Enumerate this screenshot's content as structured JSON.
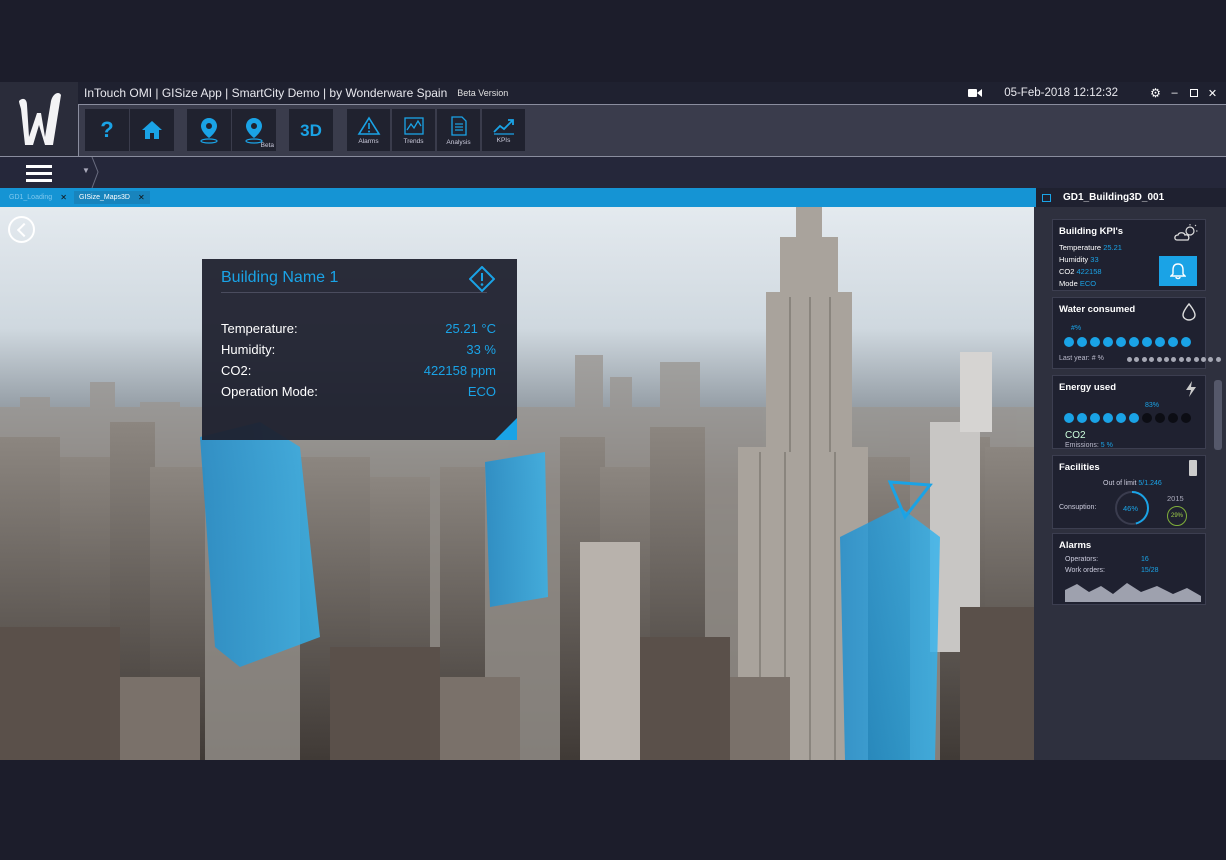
{
  "title_bar": {
    "app_title": "InTouch OMI | GISize App | SmartCity Demo | by Wonderware Spain",
    "beta_tag": "Beta Version",
    "datetime": "05-Feb-2018 12:12:32"
  },
  "toolbar": {
    "help_glyph": "?",
    "three_d_label": "3D",
    "location_beta_label": "Beta",
    "alarms_label": "Alarms",
    "trends_label": "Trends",
    "analysis_label": "Analysis",
    "kpis_label": "KPIs"
  },
  "tabs": [
    {
      "label": "GD1_Loading"
    },
    {
      "label": "GISize_Maps3D"
    }
  ],
  "tab_close": "✕",
  "panel": {
    "title": "GD1_Building3D_001"
  },
  "info_popup": {
    "building_name": "Building Name 1",
    "rows": [
      {
        "label": "Temperature:",
        "value": "25.21 °C"
      },
      {
        "label": "Humidity:",
        "value": "33 %"
      },
      {
        "label": "CO2:",
        "value": "422158 ppm"
      },
      {
        "label": "Operation Mode:",
        "value": "ECO"
      }
    ]
  },
  "kpi_card": {
    "title": "Building KPI's",
    "temperature_label": "Temperature",
    "temperature_value": "25.21",
    "humidity_label": "Humidity",
    "humidity_value": "33",
    "co2_label": "CO2",
    "co2_value": "422158",
    "mode_label": "Mode",
    "mode_value": "ECO"
  },
  "water_card": {
    "title": "Water consumed",
    "percent_label": "#%",
    "last_year_label": "Last year:",
    "last_year_value": "#",
    "last_year_unit": "%",
    "filled_dots": 10,
    "total_dots": 10
  },
  "energy_card": {
    "title": "Energy used",
    "percent_label": "83%",
    "co2_label": "CO2",
    "emissions_label": "Emissions:",
    "emissions_value": "5",
    "emissions_unit": "%",
    "filled_dots": 6,
    "total_dots": 10
  },
  "facilities_card": {
    "title": "Facilities",
    "out_of_limit_label": "Out of limit",
    "out_of_limit_value": "5/1.246",
    "consumption_label": "Consuption:",
    "consumption_value": "46%",
    "consumption_fraction": 0.46,
    "year_label": "2015",
    "year_value": "29%"
  },
  "alarms_card": {
    "title": "Alarms",
    "operators_label": "Operators:",
    "operators_value": "16",
    "work_orders_label": "Work orders:",
    "work_orders_value": "15/28"
  },
  "colors": {
    "accent": "#1aa3e6",
    "background": "#1c1d2b",
    "panel": "#2e303e"
  }
}
